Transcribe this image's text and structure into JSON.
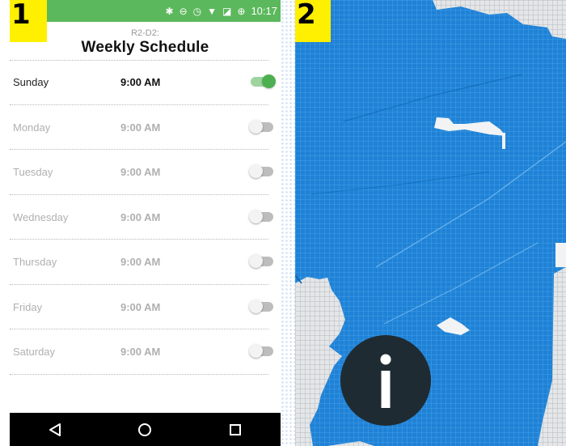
{
  "steps": {
    "one": "1",
    "two": "2"
  },
  "status_bar": {
    "time": "10:17",
    "icons": [
      "bluetooth-icon",
      "do-not-disturb-icon",
      "alarm-icon",
      "wifi-icon",
      "no-sim-icon",
      "battery-saver-icon"
    ]
  },
  "header": {
    "subtitle": "R2-D2:",
    "title": "Weekly Schedule"
  },
  "schedule": [
    {
      "day": "Sunday",
      "time": "9:00 AM",
      "enabled": true
    },
    {
      "day": "Monday",
      "time": "9:00 AM",
      "enabled": false
    },
    {
      "day": "Tuesday",
      "time": "9:00 AM",
      "enabled": false
    },
    {
      "day": "Wednesday",
      "time": "9:00 AM",
      "enabled": false
    },
    {
      "day": "Thursday",
      "time": "9:00 AM",
      "enabled": false
    },
    {
      "day": "Friday",
      "time": "9:00 AM",
      "enabled": false
    },
    {
      "day": "Saturday",
      "time": "9:00 AM",
      "enabled": false
    }
  ],
  "nav_bar": {
    "buttons": [
      "back-icon",
      "home-icon",
      "recents-icon"
    ]
  },
  "map": {
    "info_icon": "info-icon"
  },
  "colors": {
    "status_bar": "#5cb85c",
    "toggle_on": "#4caf50",
    "badge": "#ffef00",
    "map_blue": "#1f82d6",
    "info_button": "#1f2b33"
  }
}
